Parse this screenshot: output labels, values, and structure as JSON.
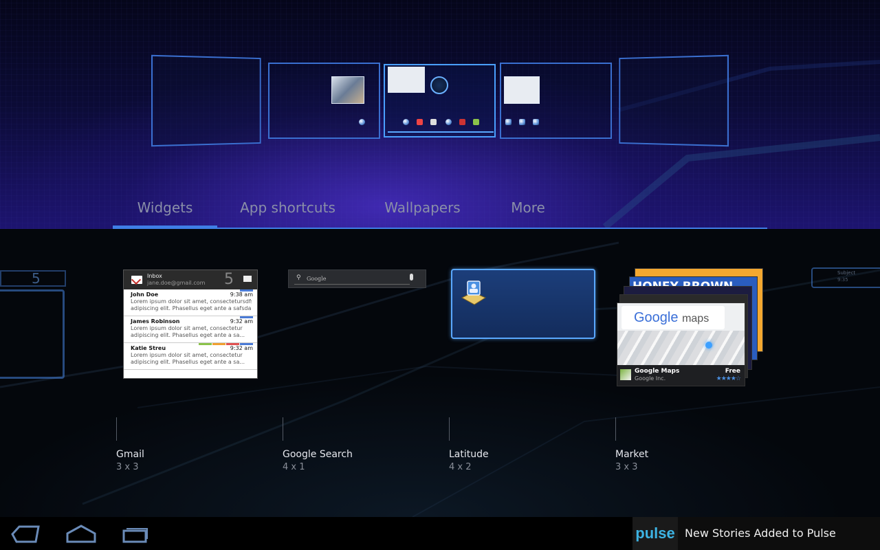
{
  "tabs": [
    {
      "label": "Widgets",
      "selected": true
    },
    {
      "label": "App shortcuts",
      "selected": false
    },
    {
      "label": "Wallpapers",
      "selected": false
    },
    {
      "label": "More",
      "selected": false
    }
  ],
  "homescreens": {
    "count": 5,
    "active_index": 2
  },
  "widgets": {
    "gmail": {
      "label": "Gmail",
      "size": "3 x 3",
      "preview": {
        "folder": "Inbox",
        "account": "jane.doe@gmail.com",
        "unread": "5",
        "messages": [
          {
            "from": "John Doe",
            "time": "9:38 am",
            "snippet_1": "Lorem ipsum dolor sit amet, consectetursdfs",
            "snippet_2": "adipiscing elit. Phasellus eget ante a safsda..."
          },
          {
            "from": "James Robinson",
            "time": "9:32 am",
            "snippet_1": "Lorem ipsum dolor sit amet, consectetur",
            "snippet_2": "adipiscing elit. Phasellus eget ante a sa..."
          },
          {
            "from": "Katie Streu",
            "time": "9:32 am",
            "snippet_1": "Lorem ipsum dolor sit amet, consectetur",
            "snippet_2": "adipiscing elit. Phasellus eget ante a sa..."
          }
        ]
      }
    },
    "google_search": {
      "label": "Google Search",
      "size": "4 x 1",
      "preview": {
        "placeholder": "Google"
      }
    },
    "latitude": {
      "label": "Latitude",
      "size": "4 x 2"
    },
    "market": {
      "label": "Market",
      "size": "3 x 3",
      "preview": {
        "banner": "HONEY BROWN",
        "logo_google": "Google",
        "logo_maps": "maps",
        "app_name": "Google Maps",
        "developer": "Google Inc.",
        "price": "Free",
        "stars": "★★★★☆"
      }
    }
  },
  "neighbor_widgets": {
    "left_count": "5",
    "right_name": "Subject",
    "right_time": "9:35"
  },
  "navbar": {
    "back_icon": "back-icon",
    "home_icon": "home-icon",
    "recent_icon": "recent-apps-icon"
  },
  "notification": {
    "app": "pulse",
    "message": "New Stories Added to Pulse"
  },
  "colors": {
    "accent": "#3f7ee6",
    "active_frame": "#4aa0ff",
    "pulse_blue": "#3db3e3"
  }
}
